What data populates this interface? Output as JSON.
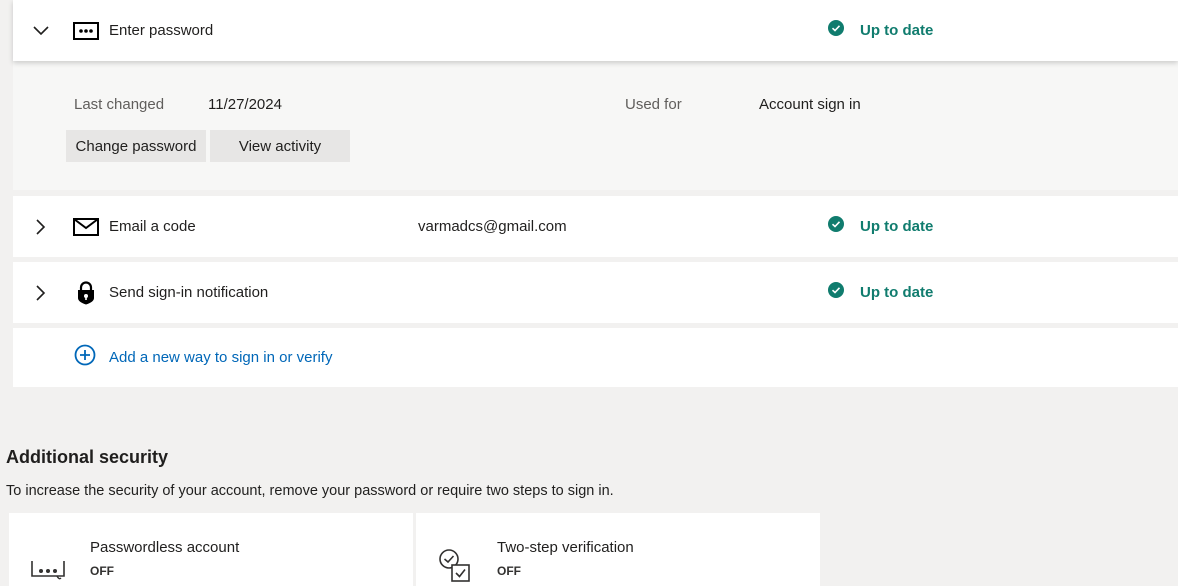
{
  "password_method": {
    "label": "Enter password",
    "status": "Up to date",
    "details": {
      "last_changed_label": "Last changed",
      "last_changed_value": "11/27/2024",
      "used_for_label": "Used for",
      "used_for_value": "Account sign in",
      "change_button": "Change password",
      "activity_button": "View activity"
    }
  },
  "email_method": {
    "label": "Email a code",
    "value": "varmadcs@gmail.com",
    "status": "Up to date"
  },
  "notification_method": {
    "label": "Send sign-in notification",
    "status": "Up to date"
  },
  "add_method": {
    "label": "Add a new way to sign in or verify"
  },
  "additional_security": {
    "heading": "Additional security",
    "description": "To increase the security of your account, remove your password or require two steps to sign in.",
    "cards": [
      {
        "title": "Passwordless account",
        "status": "OFF",
        "icon": "password-dots-icon"
      },
      {
        "title": "Two-step verification",
        "status": "OFF",
        "icon": "two-step-check-icon"
      }
    ]
  },
  "colors": {
    "status_green": "#107c6e",
    "link_blue": "#0067b8",
    "page_bg": "#f2f1f0"
  }
}
